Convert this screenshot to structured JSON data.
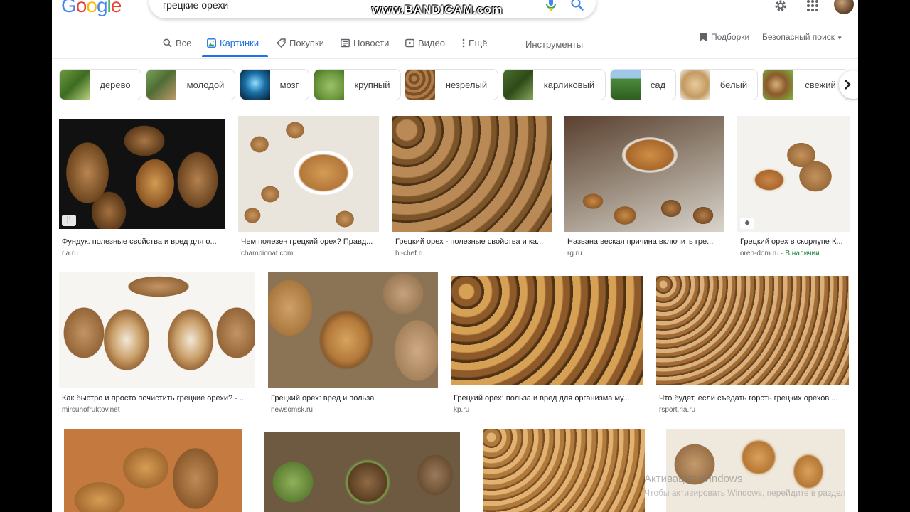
{
  "header": {
    "logo_letters": [
      "G",
      "o",
      "o",
      "g",
      "l",
      "e"
    ],
    "logo_colors": [
      "#4285f4",
      "#ea4335",
      "#fbbc05",
      "#4285f4",
      "#34a853",
      "#ea4335"
    ],
    "query": "грецкие орехи",
    "watermark": "www.BANDICAM.com"
  },
  "tabs": {
    "items": [
      {
        "label": "Все",
        "icon": "search-icon"
      },
      {
        "label": "Картинки",
        "icon": "image-icon",
        "active": true
      },
      {
        "label": "Покупки",
        "icon": "tag-icon"
      },
      {
        "label": "Новости",
        "icon": "news-icon"
      },
      {
        "label": "Видео",
        "icon": "video-icon"
      },
      {
        "label": "Ещё",
        "icon": "more-icon"
      }
    ],
    "tools": "Инструменты",
    "collections": "Подборки",
    "safesearch": "Безопасный поиск"
  },
  "chips": [
    {
      "label": "дерево"
    },
    {
      "label": "молодой"
    },
    {
      "label": "мозг"
    },
    {
      "label": "крупный"
    },
    {
      "label": "незрелый"
    },
    {
      "label": "карликовый"
    },
    {
      "label": "сад"
    },
    {
      "label": "белый"
    },
    {
      "label": "свежий"
    }
  ],
  "results": [
    {
      "title": "Фундук: полезные свойства и вред для о...",
      "source": "ria.ru"
    },
    {
      "title": "Чем полезен грецкий орех? Правд...",
      "source": "championat.com"
    },
    {
      "title": "Грецкий орех - полезные свойства и ка...",
      "source": "hi-chef.ru"
    },
    {
      "title": "Названа веская причина включить гре...",
      "source": "rg.ru"
    },
    {
      "title": "Грецкий орех в скорлупе К...",
      "source": "oreh-dom.ru",
      "availability": "· В наличии"
    },
    {
      "title": "Как быстро и просто почистить грецкие орехи? - ...",
      "source": "mirsuhofruktov.net"
    },
    {
      "title": "Грецкий орех: вред и польза",
      "source": "newsomsk.ru"
    },
    {
      "title": "Грецкий орех: польза и вред для организма му...",
      "source": "kp.ru"
    },
    {
      "title": "Что будет, если съедать горсть грецких орехов ...",
      "source": "rsport.ria.ru"
    },
    {
      "title": "",
      "source": ""
    },
    {
      "title": "",
      "source": ""
    },
    {
      "title": "",
      "source": ""
    },
    {
      "title": "",
      "source": ""
    }
  ],
  "overlay": {
    "activate_line1": "Активация Windows",
    "activate_line2": "Чтобы активировать Windows, перейдите в раздел"
  },
  "colors": {
    "accent": "#1a73e8",
    "walnut_dark": "#5a3a1c",
    "walnut_light": "#c8955a",
    "kernel": "#b9783c"
  }
}
